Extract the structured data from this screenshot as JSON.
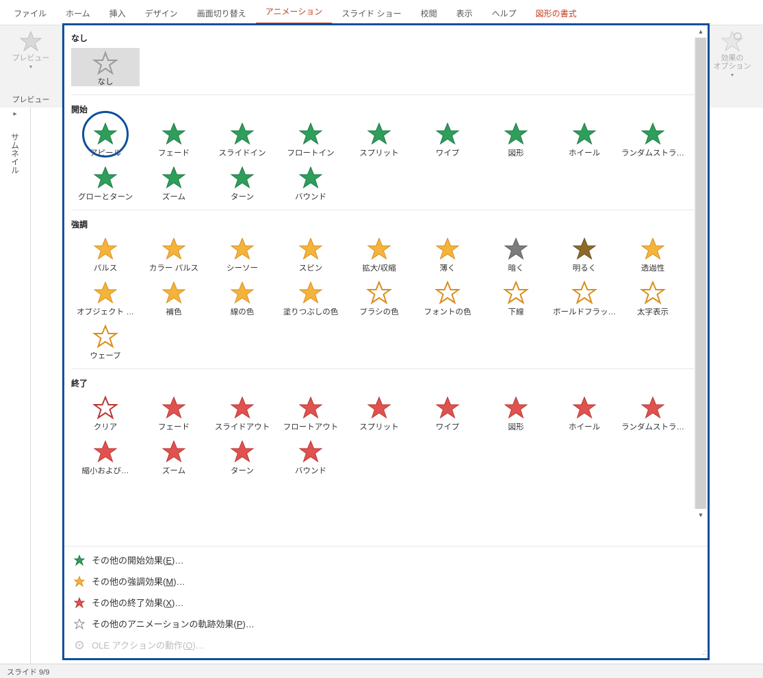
{
  "tabs": {
    "file": "ファイル",
    "home": "ホーム",
    "insert": "挿入",
    "design": "デザイン",
    "transitions": "画面切り替え",
    "animations": "アニメーション",
    "slideshow": "スライド ショー",
    "review": "校閲",
    "view": "表示",
    "help": "ヘルプ",
    "format": "図形の書式"
  },
  "ribbon": {
    "preview_btn": "プレビュー",
    "preview_group": "プレビュー",
    "effect_options_btn": "効果の",
    "effect_options_btn2": "オプション"
  },
  "side": {
    "expand": "›",
    "thumbnails": "サムネイル"
  },
  "gallery": {
    "groups": {
      "none": {
        "title": "なし",
        "items": [
          "なし"
        ]
      },
      "entrance": {
        "title": "開始",
        "items": [
          "アピール",
          "フェード",
          "スライドイン",
          "フロートイン",
          "スプリット",
          "ワイプ",
          "図形",
          "ホイール",
          "ランダムストラ…",
          "グローとターン",
          "ズーム",
          "ターン",
          "バウンド"
        ]
      },
      "emphasis": {
        "title": "強調",
        "items": [
          "パルス",
          "カラー パルス",
          "シーソー",
          "スピン",
          "拡大/収縮",
          "薄く",
          "暗く",
          "明るく",
          "透過性",
          "オブジェクト …",
          "補色",
          "線の色",
          "塗りつぶしの色",
          "ブラシの色",
          "フォントの色",
          "下線",
          "ボールドフラッ…",
          "太字表示",
          "ウェーブ"
        ]
      },
      "exit": {
        "title": "終了",
        "items": [
          "クリア",
          "フェード",
          "スライドアウト",
          "フロートアウト",
          "スプリット",
          "ワイプ",
          "図形",
          "ホイール",
          "ランダムストラ…",
          "縮小および…",
          "ズーム",
          "ターン",
          "バウンド"
        ]
      }
    },
    "menu": {
      "more_entrance": "その他の開始効果(E)…",
      "more_emphasis": "その他の強調効果(M)…",
      "more_exit": "その他の終了効果(X)…",
      "more_motion": "その他のアニメーションの軌跡効果(P)…",
      "ole": "OLE アクションの動作(O)…",
      "acc": {
        "e": "E",
        "m": "M",
        "x": "X",
        "p": "P",
        "o": "O"
      }
    }
  },
  "status": {
    "slide": "スライド 9/9"
  },
  "colors": {
    "entrance_fill": "#2e9e5b",
    "entrance_stroke": "#1f7a43",
    "emphasis_fill": "#f4b43b",
    "emphasis_stroke": "#d98d1b",
    "exit_fill": "#e0524f",
    "exit_stroke": "#b83633",
    "none_fill": "#cfcfcf",
    "none_stroke": "#9a9a9a",
    "grey_star": "#bfbfbf"
  }
}
